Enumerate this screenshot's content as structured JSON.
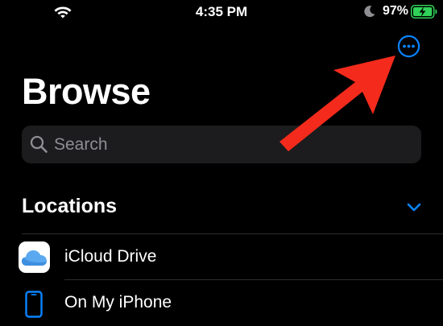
{
  "status_bar": {
    "time": "4:35 PM",
    "battery_percent": "97%",
    "battery_level": 0.97,
    "icons": [
      "wifi-icon",
      "moon-icon",
      "battery-charging-icon"
    ]
  },
  "header": {
    "title": "Browse",
    "more_icon": "ellipsis-circle-icon"
  },
  "search": {
    "placeholder": "Search",
    "value": ""
  },
  "locations": {
    "title": "Locations",
    "items": [
      {
        "label": "iCloud Drive",
        "icon": "icloud-drive-icon"
      },
      {
        "label": "On My iPhone",
        "icon": "iphone-icon"
      }
    ]
  },
  "colors": {
    "accent": "#0a84ff",
    "annotation_arrow": "#f42b1c",
    "background": "#000000",
    "search_field": "#1c1c1e",
    "placeholder": "#8e8e93",
    "battery_charging": "#30d158"
  }
}
